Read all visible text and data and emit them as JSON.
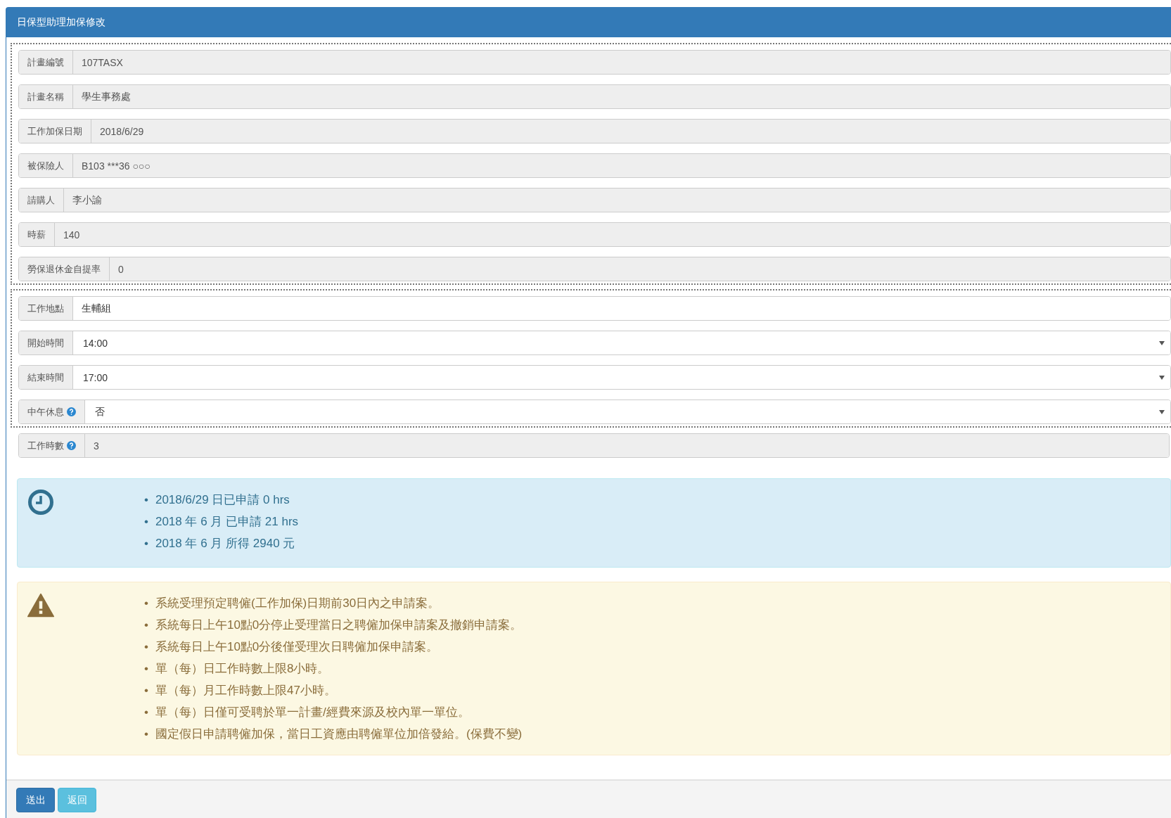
{
  "panel": {
    "title": "日保型助理加保修改"
  },
  "groups": [
    {
      "bordered": true,
      "fields": [
        {
          "label": "計畫編號",
          "kind": "readonly",
          "value": "107TASX",
          "help": false
        },
        {
          "label": "計畫名稱",
          "kind": "readonly",
          "value": "學生事務處",
          "help": false
        },
        {
          "label": "工作加保日期",
          "kind": "readonly",
          "value": "2018/6/29",
          "help": false
        },
        {
          "label": "被保險人",
          "kind": "readonly",
          "value": "B103 ***36 ○○○",
          "help": false
        },
        {
          "label": "請購人",
          "kind": "readonly",
          "value": "李小諭",
          "help": false
        },
        {
          "label": "時薪",
          "kind": "readonly",
          "value": "140",
          "help": false
        },
        {
          "label": "勞保退休金自提率",
          "kind": "readonly",
          "value": "0",
          "help": false
        }
      ]
    },
    {
      "bordered": true,
      "fields": [
        {
          "label": "工作地點",
          "kind": "text",
          "value": "生輔組",
          "help": false
        },
        {
          "label": "開始時間",
          "kind": "select",
          "value": "14:00",
          "help": false
        },
        {
          "label": "結束時間",
          "kind": "select",
          "value": "17:00",
          "help": false
        },
        {
          "label": "中午休息",
          "kind": "select",
          "value": "否",
          "help": true
        }
      ]
    },
    {
      "bordered": false,
      "fields": [
        {
          "label": "工作時數",
          "kind": "readonly",
          "value": "3",
          "help": true
        }
      ]
    }
  ],
  "alerts": [
    {
      "kind": "info",
      "marker": "•",
      "items": [
        "2018/6/29 日已申請 0 hrs",
        "2018 年 6 月 已申請 21 hrs",
        "2018 年 6 月 所得 2940 元"
      ]
    },
    {
      "kind": "warning",
      "marker": "•",
      "items": [
        "系統受理預定聘僱(工作加保)日期前30日內之申請案。",
        "系統每日上午10點0分停止受理當日之聘僱加保申請案及撤銷申請案。",
        "系統每日上午10點0分後僅受理次日聘僱加保申請案。",
        "單（每）日工作時數上限8小時。",
        "單（每）月工作時數上限47小時。",
        "單（每）日僅可受聘於單一計畫/經費來源及校內單一單位。",
        "國定假日申請聘僱加保，當日工資應由聘僱單位加倍發給。(保費不變)"
      ]
    }
  ],
  "buttons": [
    {
      "label": "送出",
      "kind": "primary"
    },
    {
      "label": "返回",
      "kind": "info"
    }
  ]
}
